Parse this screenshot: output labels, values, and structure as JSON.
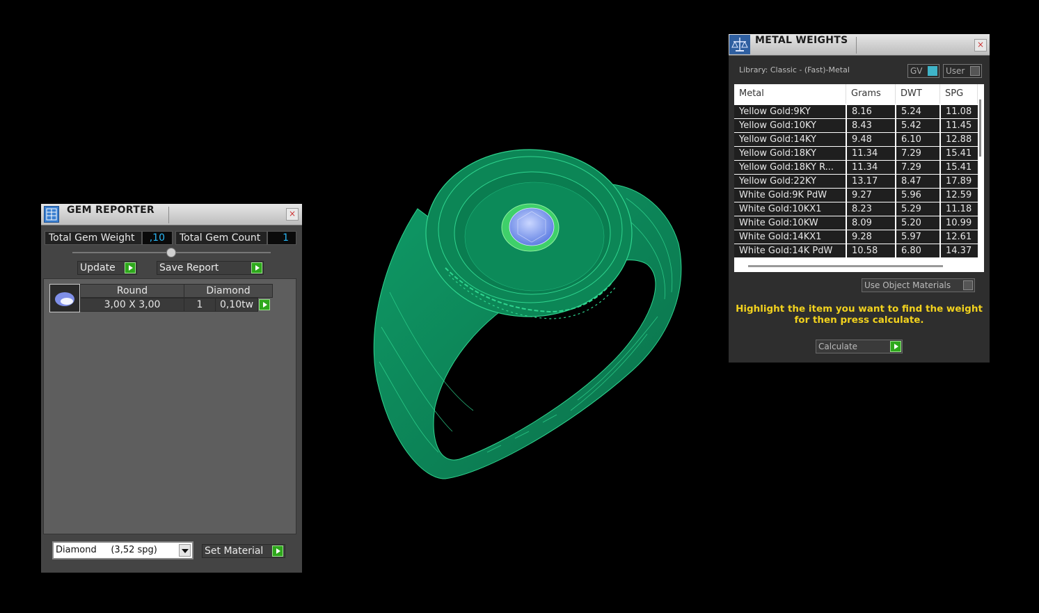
{
  "gem_reporter": {
    "title": "GEM REPORTER",
    "close": "×",
    "total_weight_label": "Total Gem Weight",
    "total_weight_value": ",10",
    "total_count_label": "Total Gem Count",
    "total_count_value": "1",
    "update_label": "Update",
    "save_label": "Save Report",
    "row": {
      "shape": "Round",
      "material": "Diamond",
      "size": "3,00 X 3,00",
      "qty": "1",
      "carat": "0,10tw"
    },
    "material_select": "Diamond     (3,52 spg)",
    "set_material_label": "Set Material"
  },
  "metal_weights": {
    "title": "METAL WEIGHTS",
    "close": "×",
    "library": "Library: Classic - (Fast)-Metal",
    "gv_label": "GV",
    "user_label": "User",
    "columns": [
      "Metal",
      "Grams",
      "DWT",
      "SPG"
    ],
    "rows": [
      [
        "Yellow Gold:9KY",
        "8.16",
        "5.24",
        "11.08"
      ],
      [
        "Yellow Gold:10KY",
        "8.43",
        "5.42",
        "11.45"
      ],
      [
        "Yellow Gold:14KY",
        "9.48",
        "6.10",
        "12.88"
      ],
      [
        "Yellow Gold:18KY",
        "11.34",
        "7.29",
        "15.41"
      ],
      [
        "Yellow Gold:18KY R...",
        "11.34",
        "7.29",
        "15.41"
      ],
      [
        "Yellow Gold:22KY",
        "13.17",
        "8.47",
        "17.89"
      ],
      [
        "White Gold:9K PdW",
        "9.27",
        "5.96",
        "12.59"
      ],
      [
        "White Gold:10KX1",
        "8.23",
        "5.29",
        "11.18"
      ],
      [
        "White Gold:10KW",
        "8.09",
        "5.20",
        "10.99"
      ],
      [
        "White Gold:14KX1",
        "9.28",
        "5.97",
        "12.61"
      ],
      [
        "White Gold:14K PdW",
        "10.58",
        "6.80",
        "14.37"
      ]
    ],
    "use_object_materials": "Use Object Materials",
    "hint_line1": "Highlight the item you want to find the weight",
    "hint_line2": "for then press calculate.",
    "calculate_label": "Calculate"
  },
  "colors": {
    "ring": "#0d8a5a",
    "ring_wire": "#2fd58f",
    "gem": "#8fa6f2",
    "accent_value": "#29b7f5",
    "hint_text": "#f2d21e",
    "go_button": "#2ea81c"
  }
}
